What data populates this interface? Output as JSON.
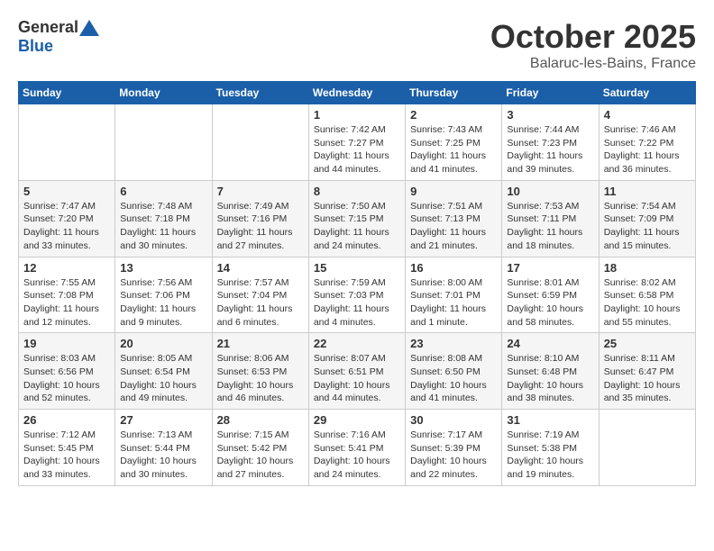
{
  "header": {
    "logo_general": "General",
    "logo_blue": "Blue",
    "title": "October 2025",
    "subtitle": "Balaruc-les-Bains, France"
  },
  "days_of_week": [
    "Sunday",
    "Monday",
    "Tuesday",
    "Wednesday",
    "Thursday",
    "Friday",
    "Saturday"
  ],
  "weeks": [
    [
      {
        "day": "",
        "info": ""
      },
      {
        "day": "",
        "info": ""
      },
      {
        "day": "",
        "info": ""
      },
      {
        "day": "1",
        "info": "Sunrise: 7:42 AM\nSunset: 7:27 PM\nDaylight: 11 hours and 44 minutes."
      },
      {
        "day": "2",
        "info": "Sunrise: 7:43 AM\nSunset: 7:25 PM\nDaylight: 11 hours and 41 minutes."
      },
      {
        "day": "3",
        "info": "Sunrise: 7:44 AM\nSunset: 7:23 PM\nDaylight: 11 hours and 39 minutes."
      },
      {
        "day": "4",
        "info": "Sunrise: 7:46 AM\nSunset: 7:22 PM\nDaylight: 11 hours and 36 minutes."
      }
    ],
    [
      {
        "day": "5",
        "info": "Sunrise: 7:47 AM\nSunset: 7:20 PM\nDaylight: 11 hours and 33 minutes."
      },
      {
        "day": "6",
        "info": "Sunrise: 7:48 AM\nSunset: 7:18 PM\nDaylight: 11 hours and 30 minutes."
      },
      {
        "day": "7",
        "info": "Sunrise: 7:49 AM\nSunset: 7:16 PM\nDaylight: 11 hours and 27 minutes."
      },
      {
        "day": "8",
        "info": "Sunrise: 7:50 AM\nSunset: 7:15 PM\nDaylight: 11 hours and 24 minutes."
      },
      {
        "day": "9",
        "info": "Sunrise: 7:51 AM\nSunset: 7:13 PM\nDaylight: 11 hours and 21 minutes."
      },
      {
        "day": "10",
        "info": "Sunrise: 7:53 AM\nSunset: 7:11 PM\nDaylight: 11 hours and 18 minutes."
      },
      {
        "day": "11",
        "info": "Sunrise: 7:54 AM\nSunset: 7:09 PM\nDaylight: 11 hours and 15 minutes."
      }
    ],
    [
      {
        "day": "12",
        "info": "Sunrise: 7:55 AM\nSunset: 7:08 PM\nDaylight: 11 hours and 12 minutes."
      },
      {
        "day": "13",
        "info": "Sunrise: 7:56 AM\nSunset: 7:06 PM\nDaylight: 11 hours and 9 minutes."
      },
      {
        "day": "14",
        "info": "Sunrise: 7:57 AM\nSunset: 7:04 PM\nDaylight: 11 hours and 6 minutes."
      },
      {
        "day": "15",
        "info": "Sunrise: 7:59 AM\nSunset: 7:03 PM\nDaylight: 11 hours and 4 minutes."
      },
      {
        "day": "16",
        "info": "Sunrise: 8:00 AM\nSunset: 7:01 PM\nDaylight: 11 hours and 1 minute."
      },
      {
        "day": "17",
        "info": "Sunrise: 8:01 AM\nSunset: 6:59 PM\nDaylight: 10 hours and 58 minutes."
      },
      {
        "day": "18",
        "info": "Sunrise: 8:02 AM\nSunset: 6:58 PM\nDaylight: 10 hours and 55 minutes."
      }
    ],
    [
      {
        "day": "19",
        "info": "Sunrise: 8:03 AM\nSunset: 6:56 PM\nDaylight: 10 hours and 52 minutes."
      },
      {
        "day": "20",
        "info": "Sunrise: 8:05 AM\nSunset: 6:54 PM\nDaylight: 10 hours and 49 minutes."
      },
      {
        "day": "21",
        "info": "Sunrise: 8:06 AM\nSunset: 6:53 PM\nDaylight: 10 hours and 46 minutes."
      },
      {
        "day": "22",
        "info": "Sunrise: 8:07 AM\nSunset: 6:51 PM\nDaylight: 10 hours and 44 minutes."
      },
      {
        "day": "23",
        "info": "Sunrise: 8:08 AM\nSunset: 6:50 PM\nDaylight: 10 hours and 41 minutes."
      },
      {
        "day": "24",
        "info": "Sunrise: 8:10 AM\nSunset: 6:48 PM\nDaylight: 10 hours and 38 minutes."
      },
      {
        "day": "25",
        "info": "Sunrise: 8:11 AM\nSunset: 6:47 PM\nDaylight: 10 hours and 35 minutes."
      }
    ],
    [
      {
        "day": "26",
        "info": "Sunrise: 7:12 AM\nSunset: 5:45 PM\nDaylight: 10 hours and 33 minutes."
      },
      {
        "day": "27",
        "info": "Sunrise: 7:13 AM\nSunset: 5:44 PM\nDaylight: 10 hours and 30 minutes."
      },
      {
        "day": "28",
        "info": "Sunrise: 7:15 AM\nSunset: 5:42 PM\nDaylight: 10 hours and 27 minutes."
      },
      {
        "day": "29",
        "info": "Sunrise: 7:16 AM\nSunset: 5:41 PM\nDaylight: 10 hours and 24 minutes."
      },
      {
        "day": "30",
        "info": "Sunrise: 7:17 AM\nSunset: 5:39 PM\nDaylight: 10 hours and 22 minutes."
      },
      {
        "day": "31",
        "info": "Sunrise: 7:19 AM\nSunset: 5:38 PM\nDaylight: 10 hours and 19 minutes."
      },
      {
        "day": "",
        "info": ""
      }
    ]
  ]
}
